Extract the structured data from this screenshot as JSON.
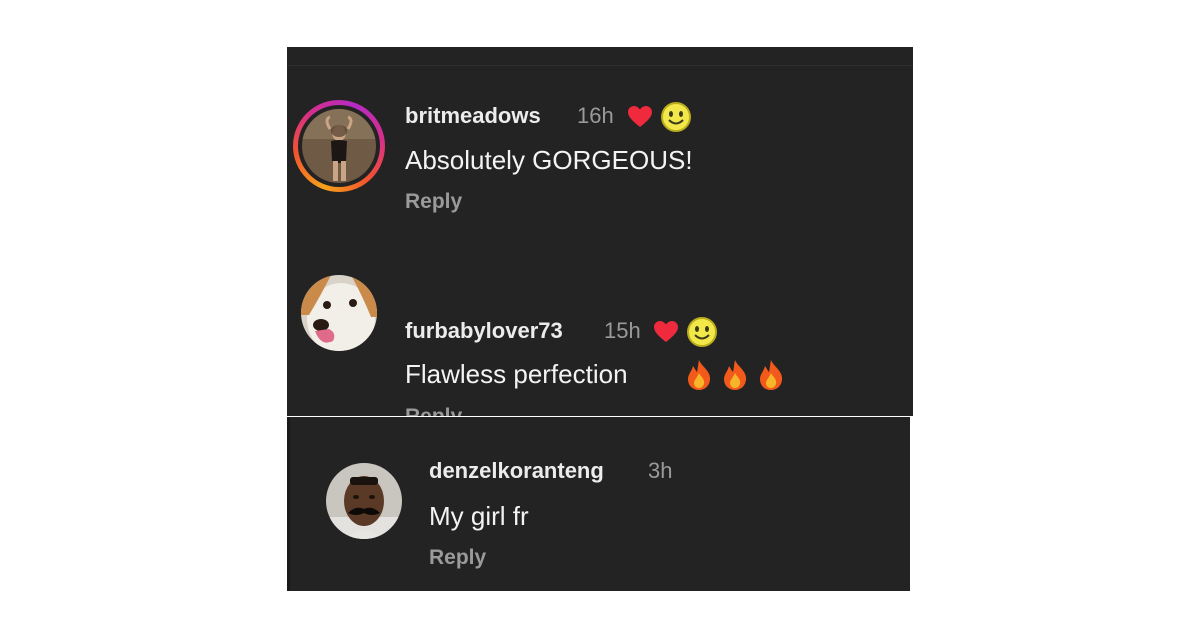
{
  "comments": [
    {
      "username": "britmeadows",
      "time": "16h",
      "text": "Absolutely GORGEOUS!",
      "reply_label": "Reply",
      "liked_by_creator": true
    },
    {
      "username": "furbabylover73",
      "time": "15h",
      "text": "Flawless perfection",
      "emoji_count": 3,
      "reply_label": "Reply",
      "liked_by_creator": true
    },
    {
      "username": "denzelkoranteng",
      "time": "3h",
      "text": "My girl fr",
      "reply_label": "Reply",
      "liked_by_creator": false
    }
  ],
  "icons": {
    "heart": "heart-icon",
    "smiley": "smiley-face-icon",
    "fire": "fire-emoji-icon"
  },
  "colors": {
    "background": "#232323",
    "heart": "#ee2a3c",
    "smiley": "#f3e84a",
    "story_ring": "#d62e8c"
  }
}
